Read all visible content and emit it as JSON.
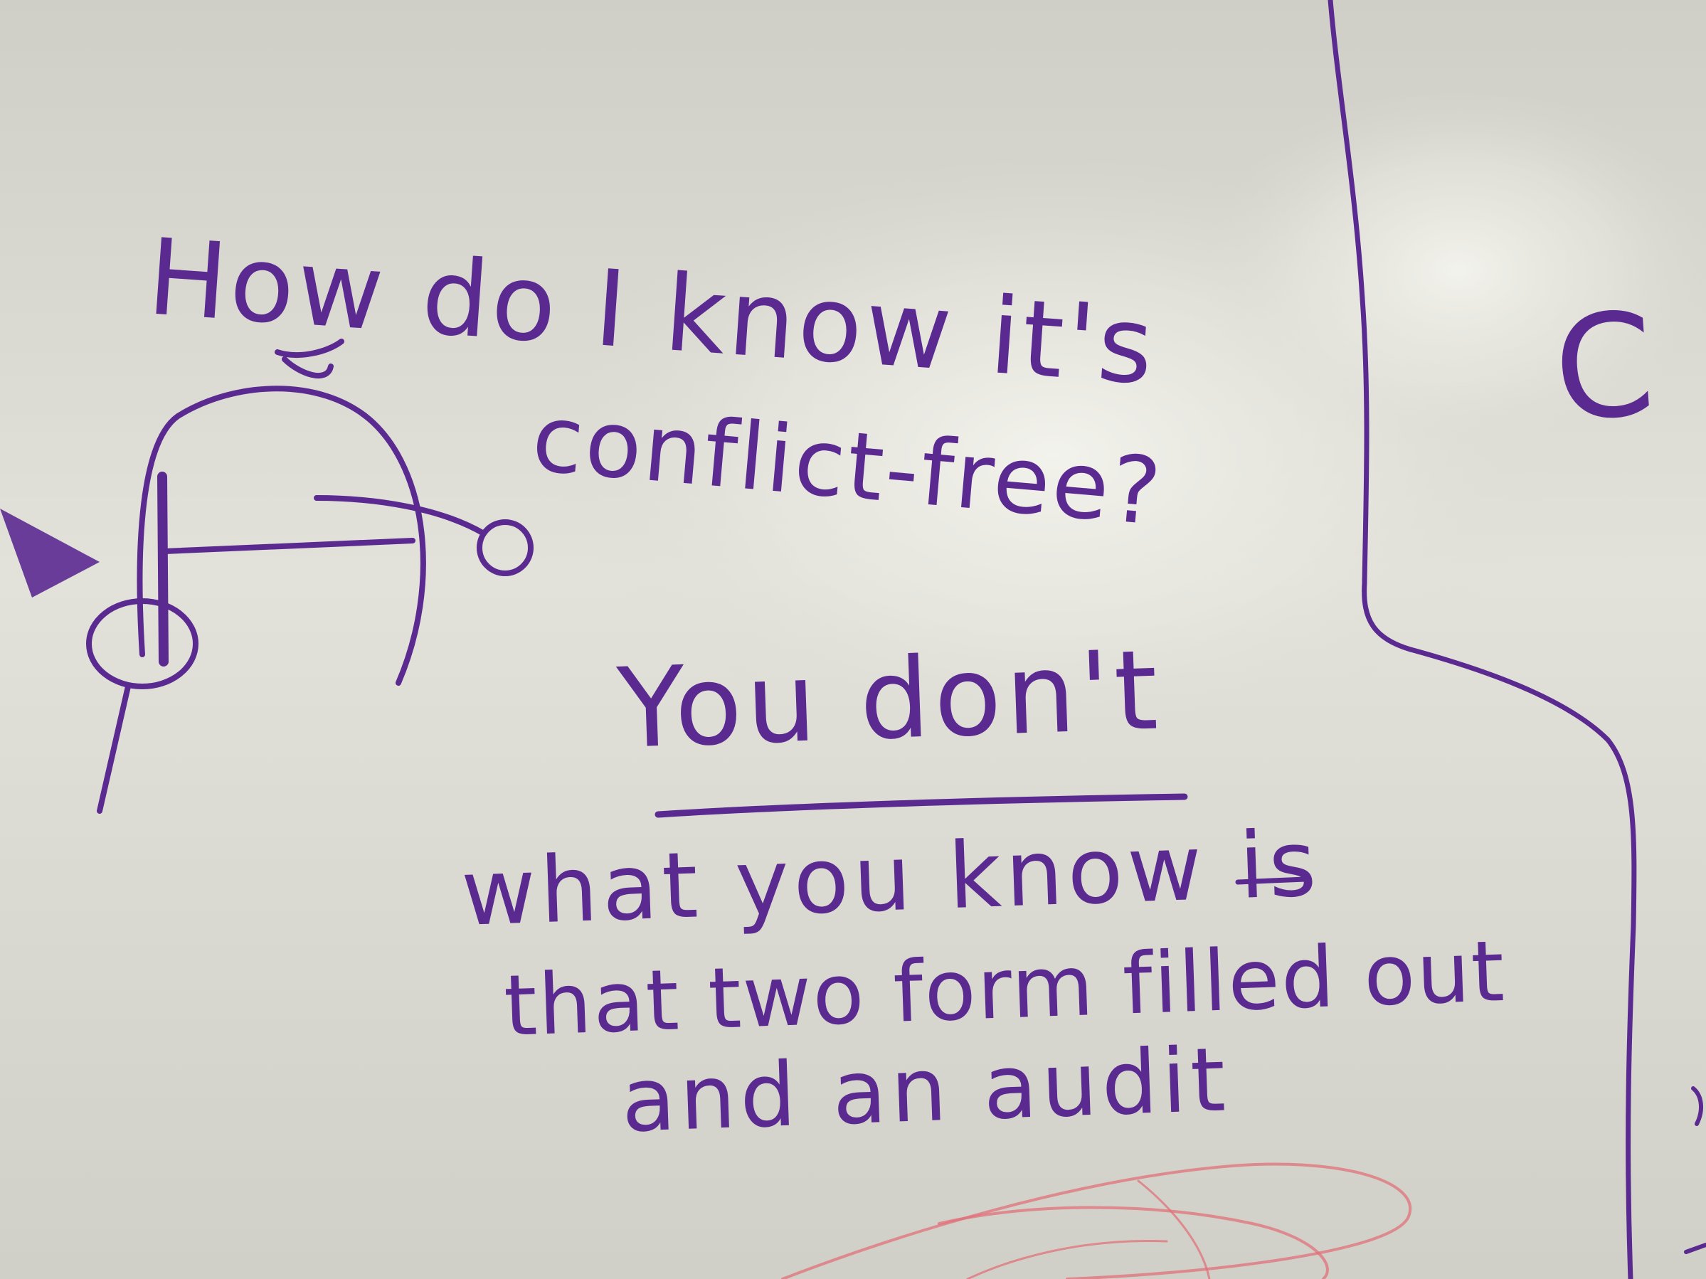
{
  "whiteboard": {
    "question_line1": "How do I know it's",
    "question_line2": "conflict-free?",
    "answer_heading": "You don't",
    "answer_line1": "what you know is",
    "answer_line2": "that two form filled out",
    "answer_line3": "and an audit",
    "margin_letter": "C"
  },
  "colors": {
    "board": "#dcdcd4",
    "marker_purple": "#5b2a90",
    "marker_red": "#e0707a"
  }
}
